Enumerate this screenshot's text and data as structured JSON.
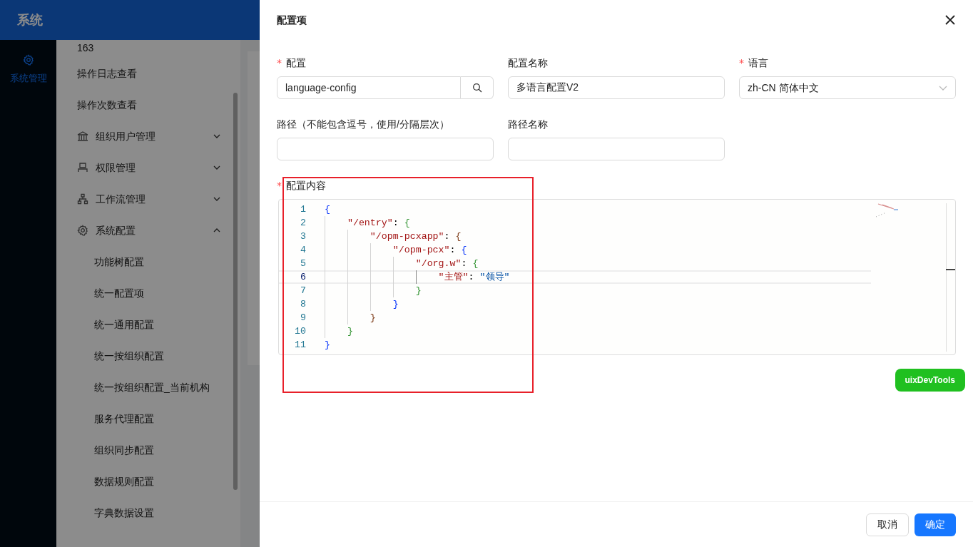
{
  "app": {
    "title": "系统",
    "rail": [
      {
        "label": "系统管理",
        "selected": true
      }
    ]
  },
  "sidebar": {
    "items": [
      {
        "label": "163",
        "kind": "link"
      },
      {
        "label": "操作日志查看",
        "kind": "link"
      },
      {
        "label": "操作次数查看",
        "kind": "link"
      },
      {
        "label": "组织用户管理",
        "kind": "group",
        "expanded": false
      },
      {
        "label": "权限管理",
        "kind": "group",
        "expanded": false
      },
      {
        "label": "工作流管理",
        "kind": "group",
        "expanded": false
      },
      {
        "label": "系统配置",
        "kind": "group",
        "expanded": true,
        "children": [
          {
            "label": "功能树配置"
          },
          {
            "label": "统一配置项"
          },
          {
            "label": "统一通用配置"
          },
          {
            "label": "统一按组织配置"
          },
          {
            "label": "统一按组织配置_当前机构"
          },
          {
            "label": "服务代理配置"
          },
          {
            "label": "组织同步配置"
          },
          {
            "label": "数据规则配置"
          },
          {
            "label": "字典数据设置"
          }
        ]
      }
    ]
  },
  "drawer": {
    "title": "配置项",
    "fields": [
      {
        "label": "配置",
        "required_mark": "*",
        "kind": "search",
        "value": "language-config"
      },
      {
        "label": "配置名称",
        "kind": "text",
        "value": "多语言配置V2"
      },
      {
        "label": "语言",
        "required_mark": "*",
        "kind": "select",
        "value": "zh-CN 简体中文"
      },
      {
        "label": "路径（不能包含逗号，使用/分隔层次）",
        "kind": "text"
      },
      {
        "label": "路径名称",
        "kind": "text"
      }
    ],
    "editor": {
      "label": "配置内容",
      "required_mark": "*",
      "lines": [
        {
          "number": "1",
          "current": false,
          "tokens": [
            {
              "text": "{",
              "kind": "bracket",
              "color": "#0431fa"
            }
          ]
        },
        {
          "number": "2",
          "current": false,
          "tokens": [
            {
              "text": "    \"/entry\"",
              "kind": "key"
            },
            {
              "text": ": ",
              "kind": "punct"
            },
            {
              "text": "{",
              "kind": "bracket",
              "color": "#319331"
            }
          ]
        },
        {
          "number": "3",
          "current": false,
          "tokens": [
            {
              "text": "        \"/opm-pcxapp\"",
              "kind": "key"
            },
            {
              "text": ": ",
              "kind": "punct"
            },
            {
              "text": "{",
              "kind": "bracket",
              "color": "#7b3814"
            }
          ]
        },
        {
          "number": "4",
          "current": false,
          "tokens": [
            {
              "text": "            \"/opm-pcx\"",
              "kind": "key"
            },
            {
              "text": ": ",
              "kind": "punct"
            },
            {
              "text": "{",
              "kind": "bracket",
              "color": "#0431fa"
            }
          ]
        },
        {
          "number": "5",
          "current": false,
          "tokens": [
            {
              "text": "                \"/org.w\"",
              "kind": "key"
            },
            {
              "text": ": ",
              "kind": "punct"
            },
            {
              "text": "{",
              "kind": "bracket",
              "color": "#319331"
            }
          ]
        },
        {
          "number": "6",
          "current": true,
          "tokens": [
            {
              "text": "                    \"主管\"",
              "kind": "key"
            },
            {
              "text": ": ",
              "kind": "punct"
            },
            {
              "text": "\"领导\"",
              "kind": "string"
            }
          ]
        },
        {
          "number": "7",
          "current": false,
          "tokens": [
            {
              "text": "                }",
              "kind": "bracket",
              "color": "#319331"
            }
          ]
        },
        {
          "number": "8",
          "current": false,
          "tokens": [
            {
              "text": "            }",
              "kind": "bracket",
              "color": "#0431fa"
            }
          ]
        },
        {
          "number": "9",
          "current": false,
          "tokens": [
            {
              "text": "        }",
              "kind": "bracket",
              "color": "#7b3814"
            }
          ]
        },
        {
          "number": "10",
          "current": false,
          "tokens": [
            {
              "text": "    }",
              "kind": "bracket",
              "color": "#319331"
            }
          ]
        },
        {
          "number": "11",
          "current": false,
          "tokens": [
            {
              "text": "}",
              "kind": "bracket",
              "color": "#0431fa"
            }
          ]
        }
      ]
    },
    "devtools_button": "uixDevTools",
    "buttons": [
      {
        "label": "取消",
        "primary": false
      },
      {
        "label": "确定",
        "primary": true
      }
    ]
  }
}
